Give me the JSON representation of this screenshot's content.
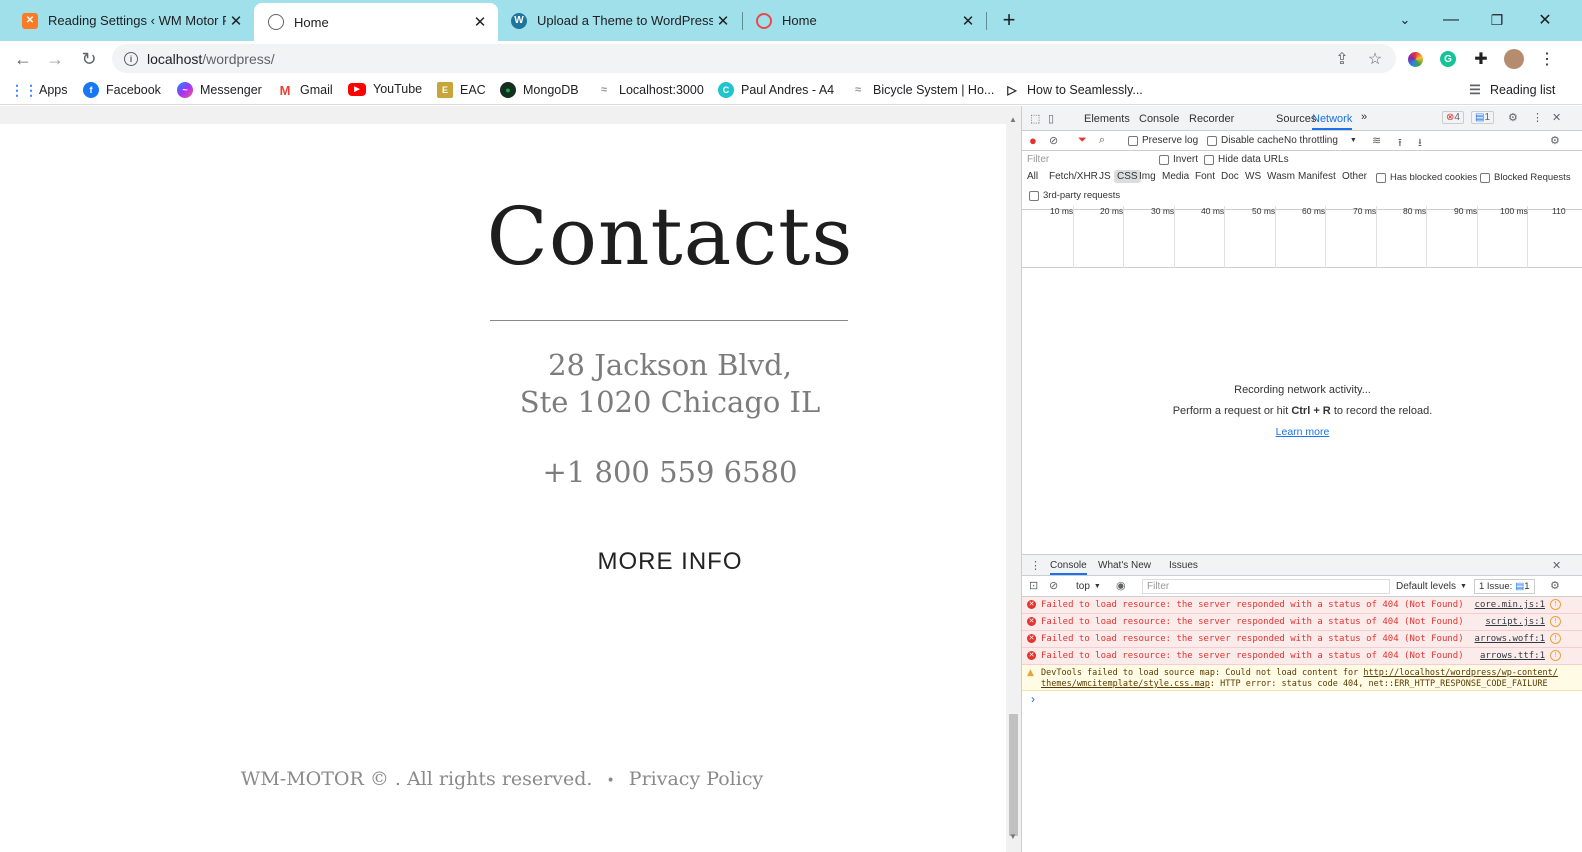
{
  "browser": {
    "tabs": [
      {
        "title": "Reading Settings ‹ WM Motor Ph",
        "favicon": "xampp-icon"
      },
      {
        "title": "Home",
        "favicon": "globe-icon"
      },
      {
        "title": "Upload a Theme to WordPress.co",
        "favicon": "wordpress-icon"
      },
      {
        "title": "Home",
        "favicon": "opera-icon"
      }
    ],
    "new_tab": "+",
    "url_host": "localhost",
    "url_path": "/wordpress/",
    "bookmarks": [
      {
        "label": "Apps",
        "icon": "apps-grid-icon",
        "color": "#4285f4"
      },
      {
        "label": "Facebook",
        "icon": "facebook-icon",
        "color": "#1877f2"
      },
      {
        "label": "Messenger",
        "icon": "messenger-icon",
        "color": "#a033ff"
      },
      {
        "label": "Gmail",
        "icon": "gmail-icon",
        "color": "#ea4335"
      },
      {
        "label": "YouTube",
        "icon": "youtube-icon",
        "color": "#ff0000"
      },
      {
        "label": "EAC",
        "icon": "eac-icon",
        "color": "#c9a43a"
      },
      {
        "label": "MongoDB",
        "icon": "mongodb-icon",
        "color": "#13aa52"
      },
      {
        "label": "Localhost:3000",
        "icon": "localhost-icon",
        "color": "#999999"
      },
      {
        "label": "Paul Andres - A4",
        "icon": "canva-icon",
        "color": "#20c4cb"
      },
      {
        "label": "Bicycle System | Ho...",
        "icon": "bicycle-icon",
        "color": "#999999"
      },
      {
        "label": "How to Seamlessly...",
        "icon": "play-icon",
        "color": "#222222"
      }
    ],
    "reading_list": "Reading list"
  },
  "page": {
    "title": "Contacts",
    "address_line1": "28 Jackson Blvd,",
    "address_line2": "Ste 1020 Chicago IL",
    "phone": "+1 800 559 6580",
    "more_info": "MORE INFO",
    "footer_text": "WM-MOTOR © . All rights reserved.",
    "footer_sep": "•",
    "privacy": "Privacy Policy"
  },
  "devtools": {
    "tabs": [
      "Elements",
      "Console",
      "Recorder",
      "Sources",
      "Network"
    ],
    "more_tabs": "»",
    "error_count": "4",
    "issue_count": "1",
    "preserve_log": "Preserve log",
    "disable_cache": "Disable cache",
    "throttling": "No throttling",
    "filter_placeholder": "Filter",
    "invert": "Invert",
    "hide_data_urls": "Hide data URLs",
    "types": [
      "All",
      "Fetch/XHR",
      "JS",
      "CSS",
      "Img",
      "Media",
      "Font",
      "Doc",
      "WS",
      "Wasm",
      "Manifest",
      "Other"
    ],
    "has_blocked_cookies": "Has blocked cookies",
    "blocked_requests": "Blocked Requests",
    "third_party": "3rd-party requests",
    "timeline_ticks": [
      "10 ms",
      "20 ms",
      "30 ms",
      "40 ms",
      "50 ms",
      "60 ms",
      "70 ms",
      "80 ms",
      "90 ms",
      "100 ms",
      "110"
    ],
    "recording": "Recording network activity...",
    "perform_prefix": "Perform a request or hit ",
    "perform_keys": "Ctrl + R",
    "perform_suffix": " to record the reload.",
    "learn_more": "Learn more",
    "drawer_tabs": [
      "Console",
      "What's New",
      "Issues"
    ],
    "context": "top",
    "console_filter": "Filter",
    "default_levels": "Default levels",
    "issues_badge": "1 Issue:",
    "issues_badge_count": "1",
    "console_messages": [
      {
        "text": "Failed to load resource: the server responded with a status of 404 (Not Found)",
        "source": "core.min.js:1"
      },
      {
        "text": "Failed to load resource: the server responded with a status of 404 (Not Found)",
        "source": "script.js:1"
      },
      {
        "text": "Failed to load resource: the server responded with a status of 404 (Not Found)",
        "source": "arrows.woff:1"
      },
      {
        "text": "Failed to load resource: the server responded with a status of 404 (Not Found)",
        "source": "arrows.ttf:1"
      }
    ],
    "warning_prefix": "DevTools failed to load source map: Could not load content for ",
    "warning_link1": "http://localhost/wordpress/wp-content/",
    "warning_link2": "themes/wmcitemplate/style.css.map",
    "warning_suffix": ": HTTP error: status code 404, net::ERR_HTTP_RESPONSE_CODE_FAILURE",
    "prompt": "›"
  }
}
